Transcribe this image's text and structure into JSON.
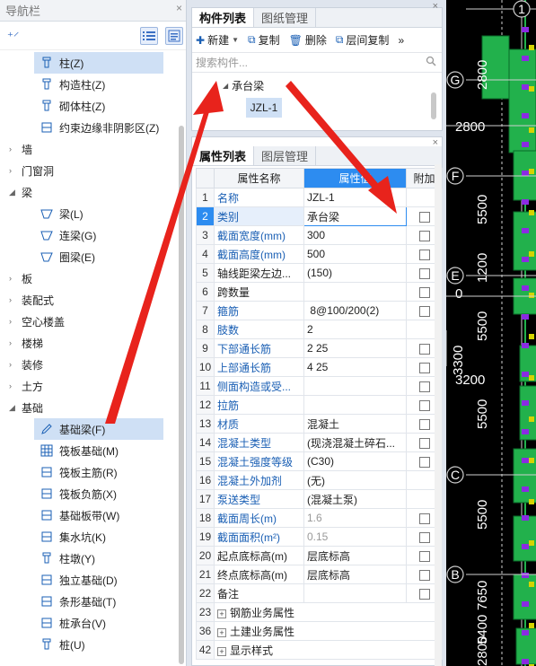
{
  "nav": {
    "title": "导航栏",
    "close": "×",
    "tree": [
      {
        "type": "item",
        "label": "柱(Z)",
        "icon": "column-icon",
        "selected": true
      },
      {
        "type": "item",
        "label": "构造柱(Z)",
        "icon": "construct-column-icon"
      },
      {
        "type": "item",
        "label": "砌体柱(Z)",
        "icon": "masonry-column-icon"
      },
      {
        "type": "item",
        "label": "约束边缘非阴影区(Z)",
        "icon": "edge-zone-icon"
      },
      {
        "type": "cat",
        "label": "墙",
        "expanded": false
      },
      {
        "type": "cat",
        "label": "门窗洞",
        "expanded": false
      },
      {
        "type": "cat",
        "label": "梁",
        "expanded": true
      },
      {
        "type": "item",
        "label": "梁(L)",
        "icon": "beam-icon"
      },
      {
        "type": "item",
        "label": "连梁(G)",
        "icon": "link-beam-icon"
      },
      {
        "type": "item",
        "label": "圈梁(E)",
        "icon": "ring-beam-icon"
      },
      {
        "type": "cat",
        "label": "板",
        "expanded": false
      },
      {
        "type": "cat",
        "label": "装配式",
        "expanded": false
      },
      {
        "type": "cat",
        "label": "空心楼盖",
        "expanded": false
      },
      {
        "type": "cat",
        "label": "楼梯",
        "expanded": false
      },
      {
        "type": "cat",
        "label": "装修",
        "expanded": false
      },
      {
        "type": "cat",
        "label": "土方",
        "expanded": false
      },
      {
        "type": "cat",
        "label": "基础",
        "expanded": true
      },
      {
        "type": "item",
        "label": "基础梁(F)",
        "icon": "foundation-beam-icon",
        "selected": true
      },
      {
        "type": "item",
        "label": "筏板基础(M)",
        "icon": "raft-foundation-icon"
      },
      {
        "type": "item",
        "label": "筏板主筋(R)",
        "icon": "raft-main-rebar-icon"
      },
      {
        "type": "item",
        "label": "筏板负筋(X)",
        "icon": "raft-neg-rebar-icon"
      },
      {
        "type": "item",
        "label": "基础板带(W)",
        "icon": "foundation-strip-icon"
      },
      {
        "type": "item",
        "label": "集水坑(K)",
        "icon": "sump-pit-icon"
      },
      {
        "type": "item",
        "label": "柱墩(Y)",
        "icon": "column-pier-icon"
      },
      {
        "type": "item",
        "label": "独立基础(D)",
        "icon": "isolated-foundation-icon"
      },
      {
        "type": "item",
        "label": "条形基础(T)",
        "icon": "strip-foundation-icon"
      },
      {
        "type": "item",
        "label": "桩承台(V)",
        "icon": "pile-cap-icon"
      },
      {
        "type": "item",
        "label": "桩(U)",
        "icon": "pile-icon"
      }
    ]
  },
  "component_panel": {
    "tabs": [
      "构件列表",
      "图纸管理"
    ],
    "active_tab": 0,
    "toolbar": {
      "new": "新建",
      "copy": "复制",
      "delete": "删除",
      "floor_copy": "层间复制",
      "more": "»"
    },
    "search_placeholder": "搜索构件...",
    "tree": {
      "group": "承台梁",
      "child": "JZL-1"
    }
  },
  "property_panel": {
    "tabs": [
      "属性列表",
      "图层管理"
    ],
    "active_tab": 0,
    "columns": [
      "",
      "属性名称",
      "属性值",
      "附加"
    ],
    "rows": [
      {
        "num": "1",
        "name": "名称",
        "value": "JZL-1",
        "blue": true,
        "check": false
      },
      {
        "num": "2",
        "name": "类别",
        "value": "承台梁",
        "blue": true,
        "check": true,
        "selected": true
      },
      {
        "num": "3",
        "name": "截面宽度(mm)",
        "value": "300",
        "blue": true,
        "check": true
      },
      {
        "num": "4",
        "name": "截面高度(mm)",
        "value": "500",
        "blue": true,
        "check": true
      },
      {
        "num": "5",
        "name": "轴线距梁左边...",
        "value": "(150)",
        "blue": false,
        "check": true
      },
      {
        "num": "6",
        "name": "跨数量",
        "value": "",
        "blue": false,
        "check": true
      },
      {
        "num": "7",
        "name": "箍筋",
        "value": " 8@100/200(2)",
        "blue": true,
        "check": true,
        "rebar": true
      },
      {
        "num": "8",
        "name": "肢数",
        "value": "2",
        "blue": true,
        "check": false
      },
      {
        "num": "9",
        "name": "下部通长筋",
        "value": "2 25",
        "blue": true,
        "check": true,
        "rebar": true
      },
      {
        "num": "10",
        "name": "上部通长筋",
        "value": "4 25",
        "blue": true,
        "check": true,
        "rebar": true
      },
      {
        "num": "11",
        "name": "侧面构造或受...",
        "value": "",
        "blue": true,
        "check": true
      },
      {
        "num": "12",
        "name": "拉筋",
        "value": "",
        "blue": true,
        "check": true
      },
      {
        "num": "13",
        "name": "材质",
        "value": "混凝土",
        "blue": true,
        "check": true
      },
      {
        "num": "14",
        "name": "混凝土类型",
        "value": "(现浇混凝土碎石...",
        "blue": true,
        "check": true
      },
      {
        "num": "15",
        "name": "混凝土强度等级",
        "value": "(C30)",
        "blue": true,
        "check": true
      },
      {
        "num": "16",
        "name": "混凝土外加剂",
        "value": "(无)",
        "blue": true,
        "check": false
      },
      {
        "num": "17",
        "name": "泵送类型",
        "value": "(混凝土泵)",
        "blue": true,
        "check": false
      },
      {
        "num": "18",
        "name": "截面周长(m)",
        "value": "1.6",
        "blue": true,
        "check": true,
        "grey": true
      },
      {
        "num": "19",
        "name": "截面面积(m²)",
        "value": "0.15",
        "blue": true,
        "check": true,
        "grey": true
      },
      {
        "num": "20",
        "name": "起点底标高(m)",
        "value": "层底标高",
        "blue": false,
        "check": true
      },
      {
        "num": "21",
        "name": "终点底标高(m)",
        "value": "层底标高",
        "blue": false,
        "check": true
      },
      {
        "num": "22",
        "name": "备注",
        "value": "",
        "blue": false,
        "check": true
      },
      {
        "num": "23",
        "name": "钢筋业务属性",
        "value": "",
        "blue": false,
        "group": true
      },
      {
        "num": "36",
        "name": "土建业务属性",
        "value": "",
        "blue": false,
        "group": true
      },
      {
        "num": "42",
        "name": "显示样式",
        "value": "",
        "blue": false,
        "group": true
      }
    ]
  },
  "cad": {
    "axes": [
      {
        "label": "1"
      },
      {
        "label": "G"
      },
      {
        "label": "F"
      },
      {
        "label": "E"
      },
      {
        "label": "C"
      },
      {
        "label": "B"
      }
    ],
    "dims": [
      "2800",
      "2800",
      "5500",
      "1200",
      "0",
      "5500",
      "3200",
      "3300",
      "5500",
      "5500",
      "7650",
      "5400",
      "2800"
    ],
    "colors": {
      "bg": "#000000",
      "green": "#22b14c",
      "axis": "#cfcfcf",
      "purple": "#8a2be2",
      "yellow": "#d4d400"
    }
  },
  "colors": {
    "accent": "#2d8cf0",
    "arrow": "#e8231c",
    "blue_text": "#1a5fb4",
    "selection": "#cfe0f5"
  }
}
